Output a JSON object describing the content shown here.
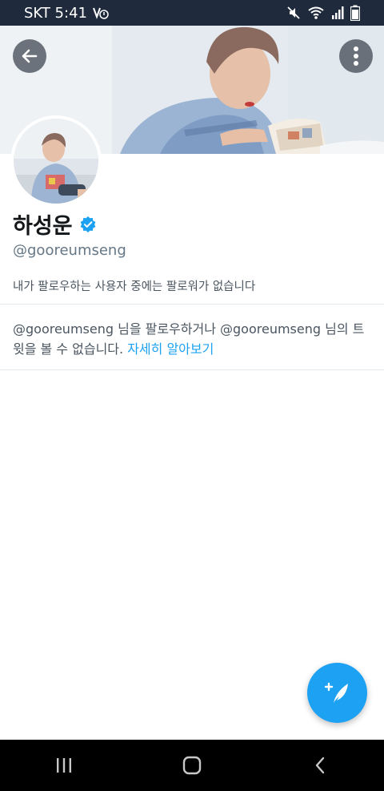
{
  "status_bar": {
    "carrier_time": "SKT 5:41",
    "icons": [
      "volte-icon",
      "mute-icon",
      "wifi-icon",
      "signal-icon",
      "battery-icon"
    ]
  },
  "header": {
    "back_icon": "arrow-left-icon",
    "more_icon": "more-vertical-icon"
  },
  "profile": {
    "name": "하성운",
    "verified": true,
    "handle": "@gooreumseng",
    "followers_you_know": "내가 팔로우하는 사용자 중에는 팔로워가 없습니다"
  },
  "notice": {
    "text": "@gooreumseng 님을 팔로우하거나 @gooreumseng 님의 트윗을 볼 수 없습니다.",
    "link": "자세히 알아보기"
  },
  "fab": {
    "icon": "compose-tweet-icon"
  },
  "nav_bar": {
    "icons": [
      "recents-icon",
      "home-icon",
      "back-icon"
    ]
  },
  "colors": {
    "accent": "#1da1f2",
    "status_bar": "#1f2b3c",
    "divider": "#e1e8ed"
  }
}
